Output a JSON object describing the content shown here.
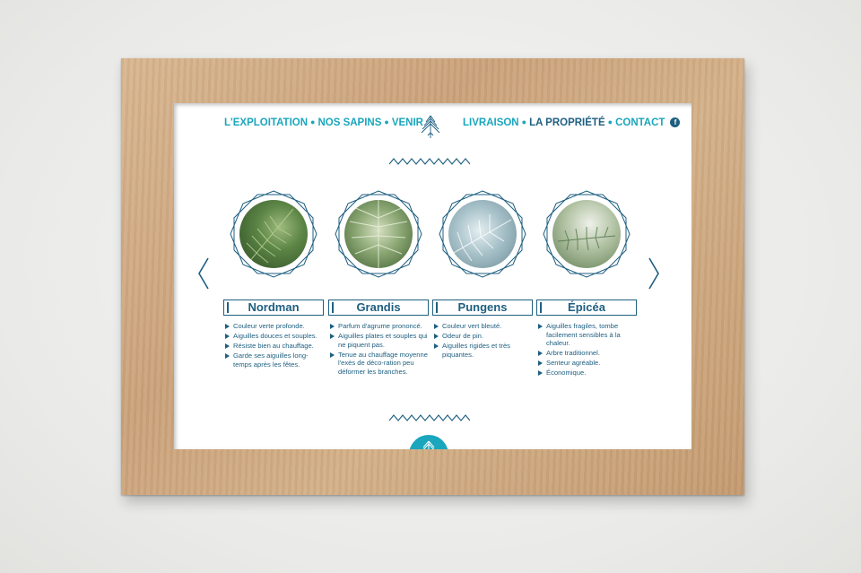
{
  "nav": {
    "left": [
      "L'EXPLOITATION",
      "NOS SAPINS",
      "VENIR"
    ],
    "right": [
      "LIVRAISON",
      "LA PROPRIÉTÉ",
      "CONTACT"
    ],
    "active": "LA PROPRIÉTÉ",
    "facebook_glyph": "f",
    "separator": "●"
  },
  "logo_icon": "tree-icon",
  "colors": {
    "accent": "#1aa6bd",
    "dark": "#1e5f80",
    "frame_wood": "#caa27a",
    "wall": "#ececea"
  },
  "carousel": {
    "prev_icon": "chevron-left-icon",
    "next_icon": "chevron-right-icon",
    "items": [
      {
        "name": "Nordman",
        "photo_tint": [
          "#3f6b34",
          "#88a96a"
        ],
        "features": [
          "Couleur verte profonde.",
          "Aiguilles douces et souples.",
          "Résiste bien au chauffage.",
          "Garde ses aiguilles long-temps après les fêtes."
        ]
      },
      {
        "name": "Grandis",
        "photo_tint": [
          "#4e6f3b",
          "#c9d6b4"
        ],
        "features": [
          "Parfum d'agrume prononcé.",
          "Aiguilles plates et souples qui ne piquent pas.",
          "Tenue au chauffage moyenne l'exès de déco-ration peu déformer les branches."
        ]
      },
      {
        "name": "Pungens",
        "photo_tint": [
          "#7fa0ad",
          "#d5e2e6"
        ],
        "features": [
          "Couleur vert bleuté.",
          "Odeur de pin.",
          "Aiguilles rigides et très piquantes."
        ]
      },
      {
        "name": "Épicéa",
        "photo_tint": [
          "#6f8c62",
          "#dfe6d8"
        ],
        "features": [
          "Aiguilles fragiles, tombe facilement sensibles à la chaleur.",
          "Arbre traditionnel.",
          "Senteur agréable.",
          "Économique."
        ]
      }
    ]
  },
  "bottom_button_icon": "tree-icon"
}
